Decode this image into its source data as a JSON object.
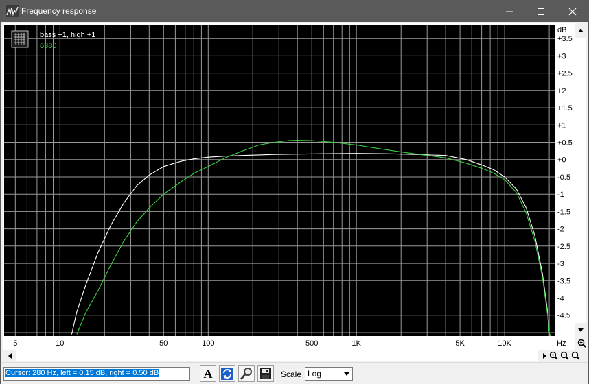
{
  "window": {
    "title": "Frequency response",
    "minimize_glyph": "—",
    "maximize_glyph": "☐",
    "close_glyph": "✕"
  },
  "legend": {
    "entries": [
      {
        "label": "bass +1, high +1",
        "color": "#ffffff"
      },
      {
        "label": "6380",
        "color": "#3ecf3e"
      }
    ]
  },
  "chart_data": {
    "type": "line",
    "xscale": "log",
    "xlim": [
      4.2,
      22000
    ],
    "ylim": [
      -5.1,
      3.9
    ],
    "ylabel": "dB",
    "xlabel": "Hz",
    "x_tick_labels": [
      {
        "value": 5,
        "label": "5"
      },
      {
        "value": 10,
        "label": "10"
      },
      {
        "value": 50,
        "label": "50"
      },
      {
        "value": 100,
        "label": "100"
      },
      {
        "value": 500,
        "label": "500"
      },
      {
        "value": 1000,
        "label": "1K"
      },
      {
        "value": 5000,
        "label": "5K"
      },
      {
        "value": 10000,
        "label": "10K"
      }
    ],
    "y_tick_labels": [
      {
        "value": 3.5,
        "label": "+3.5"
      },
      {
        "value": 3,
        "label": "+3"
      },
      {
        "value": 2.5,
        "label": "+2.5"
      },
      {
        "value": 2,
        "label": "+2"
      },
      {
        "value": 1.5,
        "label": "+1.5"
      },
      {
        "value": 1,
        "label": "+1"
      },
      {
        "value": 0.5,
        "label": "+0.5"
      },
      {
        "value": 0,
        "label": "+0"
      },
      {
        "value": -0.5,
        "label": "-0.5"
      },
      {
        "value": -1,
        "label": "-1"
      },
      {
        "value": -1.5,
        "label": "-1.5"
      },
      {
        "value": -2,
        "label": "-2"
      },
      {
        "value": -2.5,
        "label": "-2.5"
      },
      {
        "value": -3,
        "label": "-3"
      },
      {
        "value": -3.5,
        "label": "-3.5"
      },
      {
        "value": -4,
        "label": "-4"
      },
      {
        "value": -4.5,
        "label": "-4.5"
      }
    ],
    "series": [
      {
        "name": "bass +1, high +1",
        "color": "#ffffff",
        "x": [
          12,
          13,
          15,
          18,
          22,
          27,
          33,
          40,
          50,
          65,
          80,
          100,
          130,
          170,
          200,
          280,
          400,
          600,
          1000,
          1600,
          2500,
          4000,
          5500,
          7000,
          8500,
          10000,
          12000,
          14000,
          16000,
          18000,
          19500,
          20000,
          20300
        ],
        "y": [
          -5.05,
          -4.4,
          -3.6,
          -2.7,
          -1.9,
          -1.25,
          -0.75,
          -0.45,
          -0.2,
          -0.05,
          0.02,
          0.07,
          0.1,
          0.12,
          0.13,
          0.15,
          0.16,
          0.17,
          0.18,
          0.17,
          0.15,
          0.12,
          0.0,
          -0.15,
          -0.3,
          -0.5,
          -0.85,
          -1.4,
          -2.2,
          -3.3,
          -4.4,
          -5.0,
          -5.1
        ]
      },
      {
        "name": "6380",
        "color": "#3ecf3e",
        "x": [
          13,
          15,
          18,
          22,
          27,
          33,
          40,
          50,
          65,
          80,
          100,
          130,
          170,
          220,
          280,
          350,
          400,
          500,
          700,
          1000,
          1400,
          2000,
          3000,
          4000,
          5500,
          7000,
          8500,
          10000,
          12000,
          14000,
          16000,
          18000,
          19500,
          20000,
          20300
        ],
        "y": [
          -5.05,
          -4.4,
          -3.8,
          -3.05,
          -2.35,
          -1.8,
          -1.4,
          -1.0,
          -0.65,
          -0.4,
          -0.2,
          0.05,
          0.25,
          0.42,
          0.5,
          0.55,
          0.56,
          0.55,
          0.5,
          0.42,
          0.32,
          0.22,
          0.12,
          0.05,
          -0.1,
          -0.25,
          -0.4,
          -0.58,
          -0.95,
          -1.55,
          -2.35,
          -3.4,
          -4.5,
          -5.0,
          -5.1
        ]
      }
    ]
  },
  "status": {
    "cursor_text": "Cursor:  280 Hz,  left = 0.15 dB,  right = 0.50 dB",
    "scale_label": "Scale",
    "scale_value": "Log"
  },
  "toolbar": {
    "font_glyph": "A"
  }
}
